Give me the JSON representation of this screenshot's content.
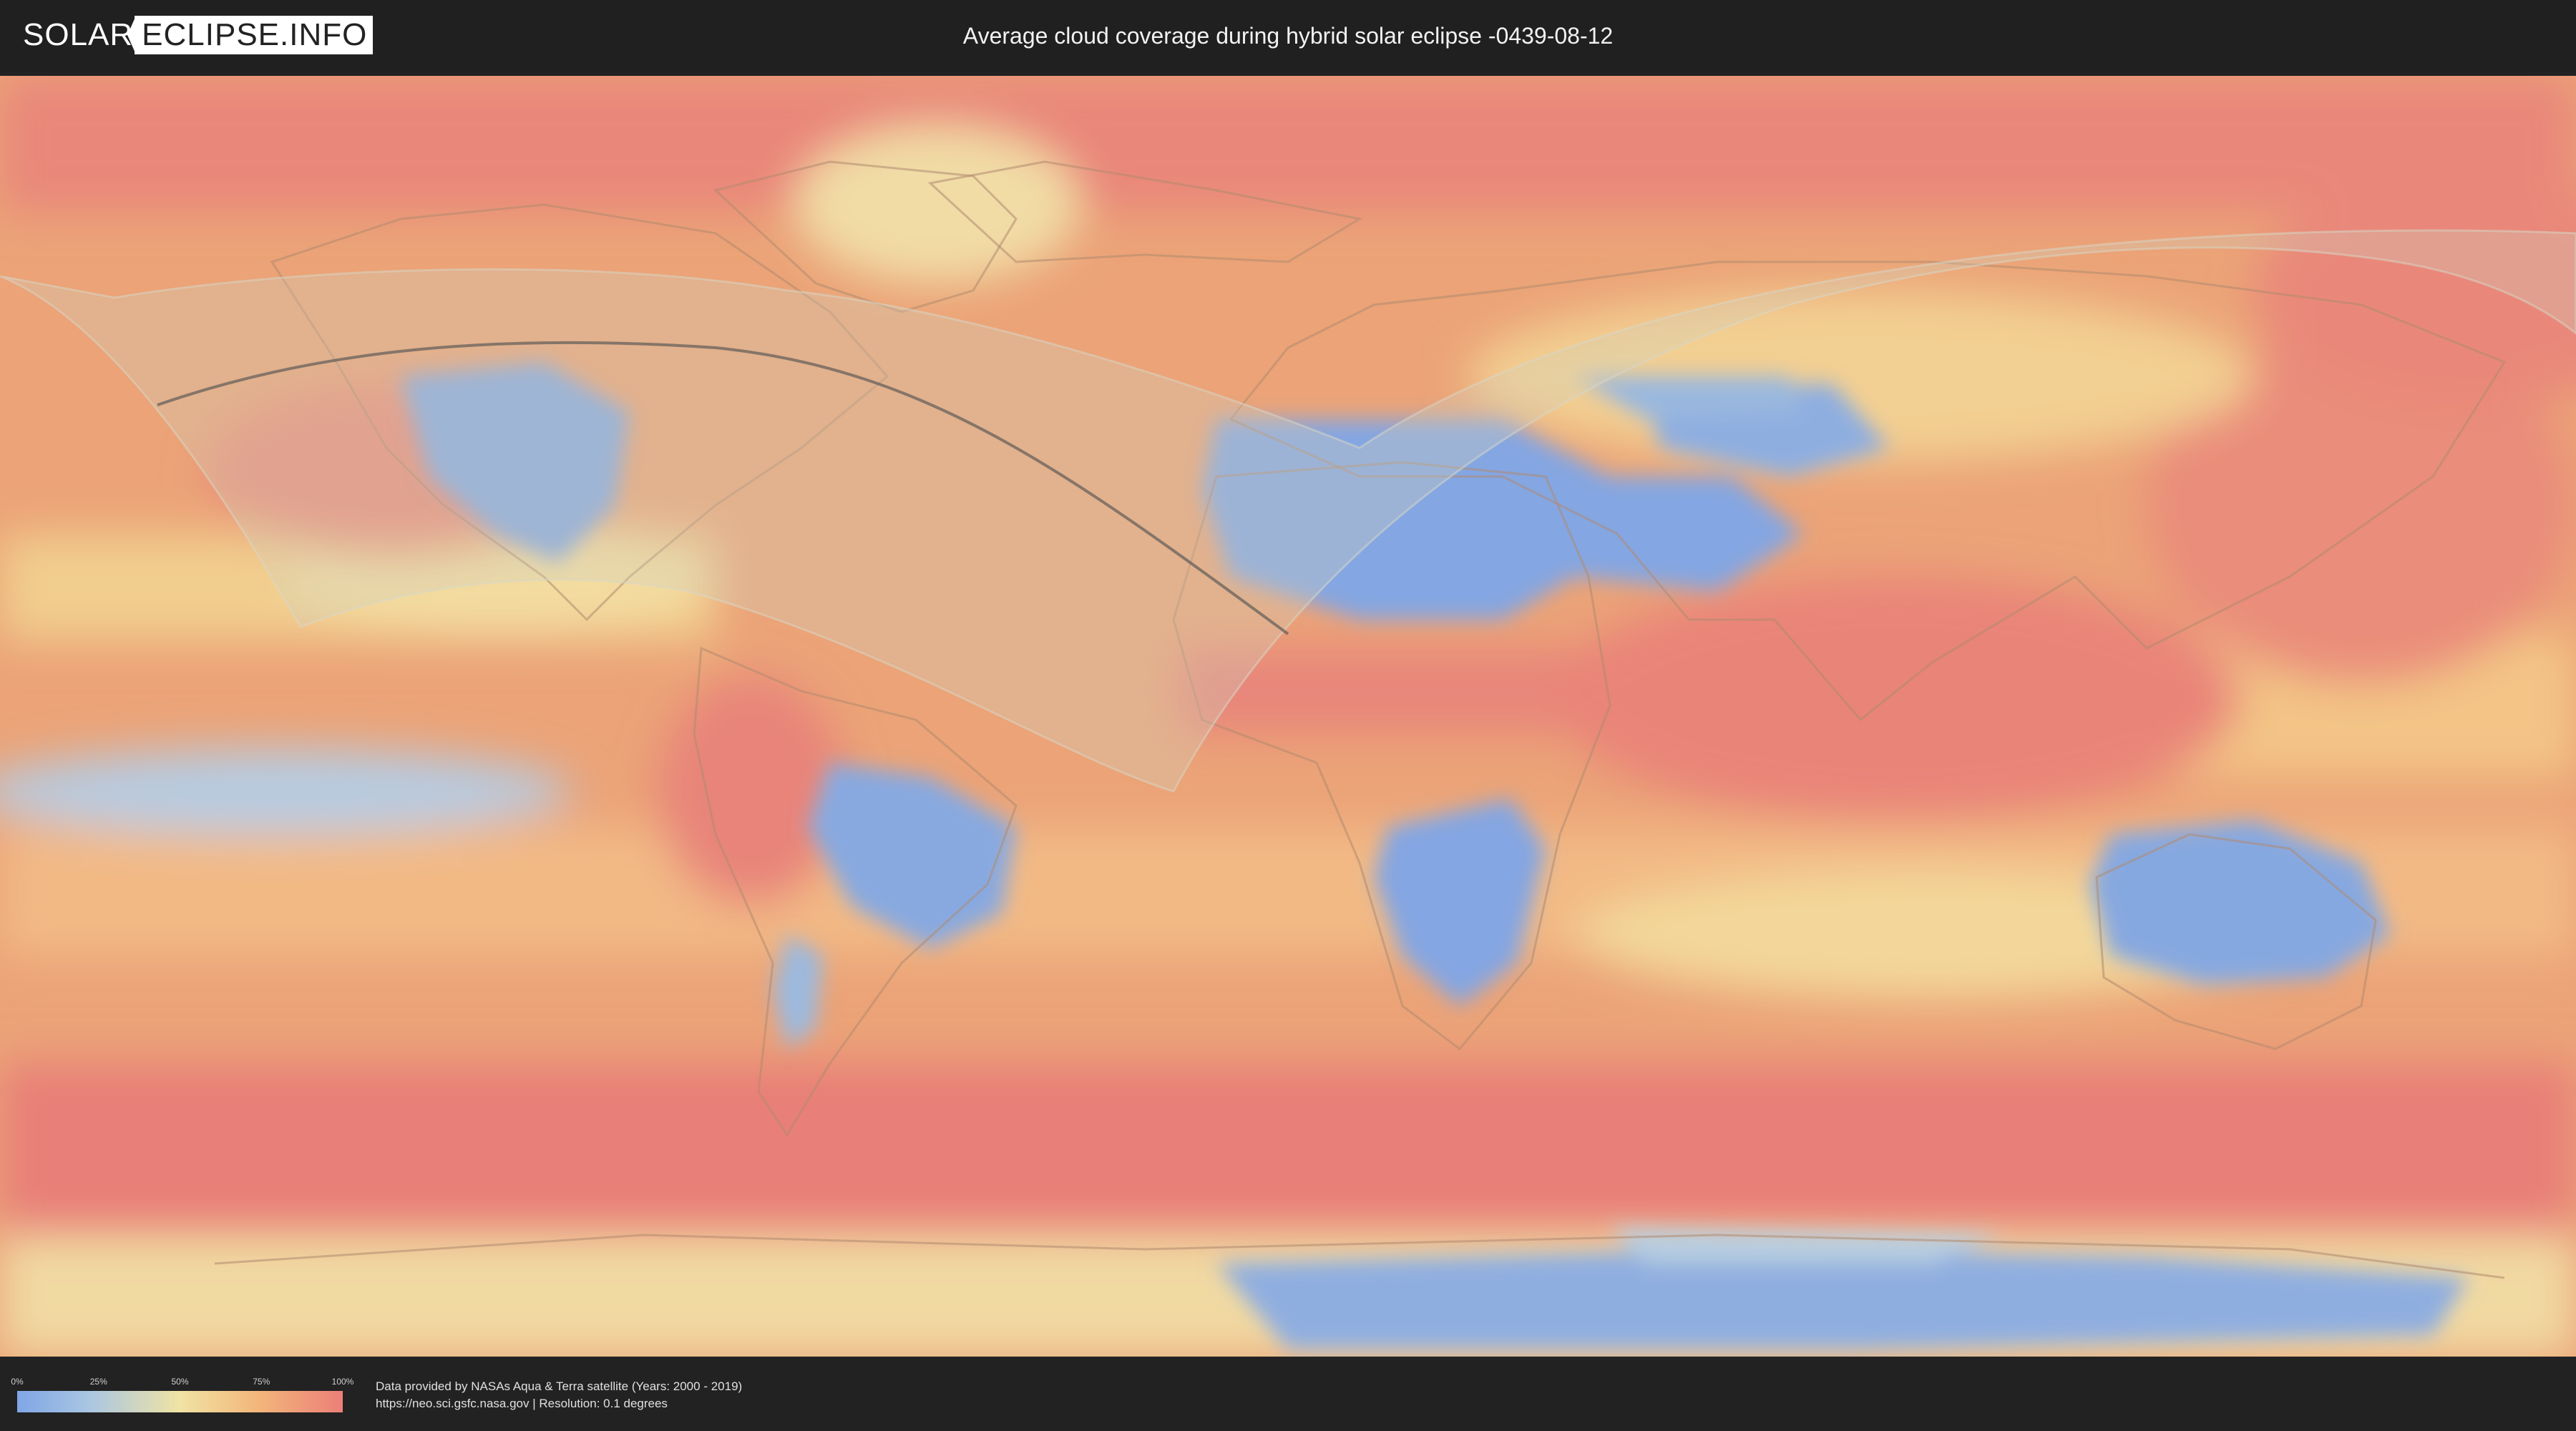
{
  "header": {
    "logo_solar": "SOLAR",
    "logo_rest": "ECLIPSE.INFO",
    "title": "Average cloud coverage during hybrid solar eclipse -0439-08-12"
  },
  "map": {
    "description_icon": "world-map-cloud-coverage",
    "colors": {
      "clear": "#7fa6e6",
      "low": "#a9c6e2",
      "mid": "#f0e3a4",
      "high": "#f2b67a",
      "overcast": "#ec7f78",
      "eclipse_zone": "#c8c8b4",
      "eclipse_path": "#555555"
    }
  },
  "legend": {
    "ticks": [
      "0%",
      "25%",
      "50%",
      "75%",
      "100%"
    ],
    "tick_fractions": [
      0,
      0.25,
      0.5,
      0.75,
      1
    ]
  },
  "footer": {
    "credit_line1": "Data provided by NASAs Aqua & Terra satellite (Years: 2000 - 2019)",
    "credit_line2": "https://neo.sci.gsfc.nasa.gov | Resolution: 0.1 degrees"
  }
}
